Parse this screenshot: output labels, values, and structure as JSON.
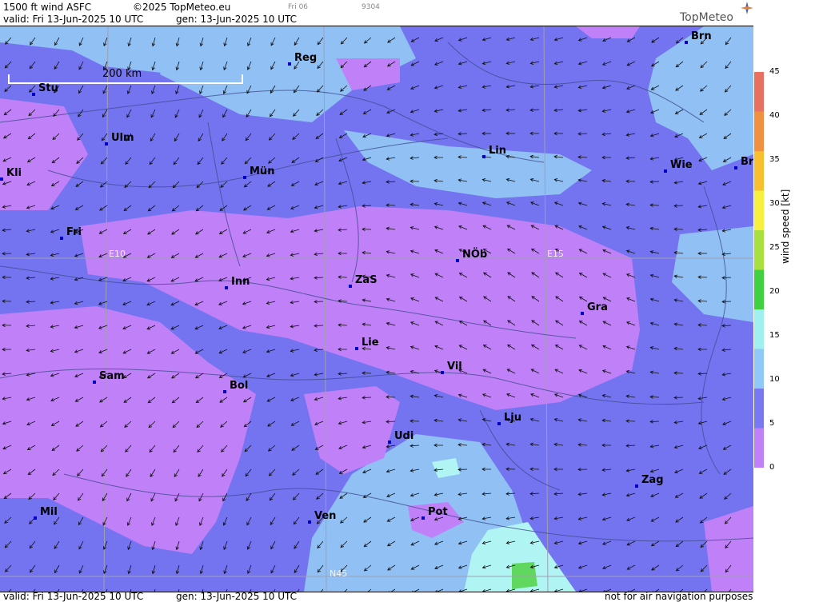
{
  "header": {
    "product": "1500 ft wind ASFC",
    "copyright": "©2025 TopMeteo.eu",
    "run": "Fri 06",
    "code": "9304",
    "valid": "valid:  Fri  13-Jun-2025  10 UTC",
    "gen": "gen: 13-Jun-2025 10 UTC",
    "logo": "TopMeteo"
  },
  "scale": {
    "label": "200 km"
  },
  "grid_labels": {
    "e10": "E10",
    "e15": "E15",
    "n45": "N45"
  },
  "cities": [
    {
      "name": "Brn"
    },
    {
      "name": "Reg"
    },
    {
      "name": "Stu"
    },
    {
      "name": "Ulm"
    },
    {
      "name": "Lin"
    },
    {
      "name": "Wie"
    },
    {
      "name": "Br"
    },
    {
      "name": "Kli"
    },
    {
      "name": "Mün"
    },
    {
      "name": "Fri"
    },
    {
      "name": "NÖb"
    },
    {
      "name": "Inn"
    },
    {
      "name": "ZaS"
    },
    {
      "name": "Gra"
    },
    {
      "name": "Lie"
    },
    {
      "name": "Vil"
    },
    {
      "name": "Sam"
    },
    {
      "name": "Bol"
    },
    {
      "name": "Lju"
    },
    {
      "name": "Udi"
    },
    {
      "name": "Zag"
    },
    {
      "name": "Mil"
    },
    {
      "name": "Ven"
    },
    {
      "name": "Pot"
    }
  ],
  "legend": {
    "title": "wind speed [kt]",
    "ticks": [
      "45",
      "40",
      "35",
      "30",
      "25",
      "20",
      "15",
      "10",
      "5",
      "0"
    ],
    "colors": [
      "#e87060",
      "#f09040",
      "#f8c030",
      "#f8f040",
      "#a8e040",
      "#40d040",
      "#a0f0f0",
      "#90c8f8",
      "#7878f0",
      "#c080f8"
    ]
  },
  "footer": {
    "valid": "valid:  Fri  13-Jun-2025  10 UTC",
    "gen": "gen: 13-Jun-2025 10 UTC",
    "disclaimer": "not for air navigation purposes"
  }
}
